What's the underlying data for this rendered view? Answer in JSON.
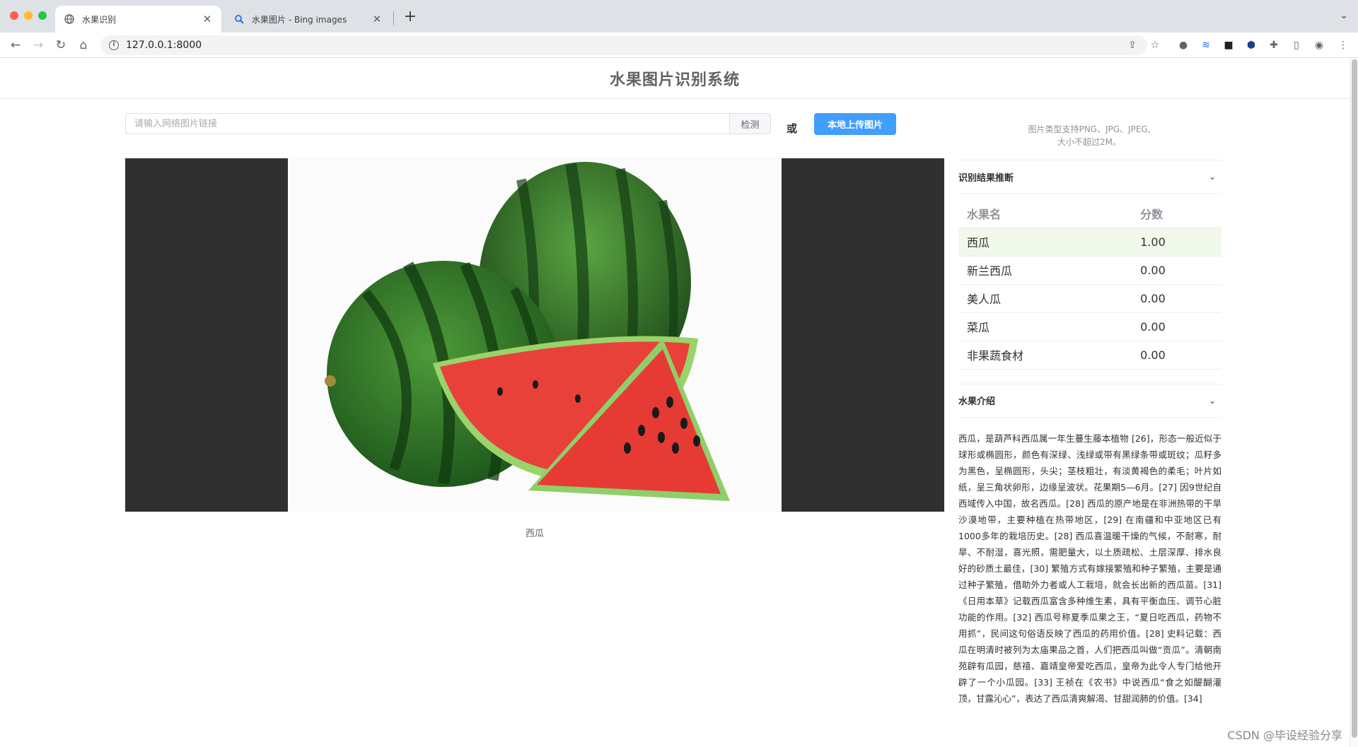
{
  "browser": {
    "tabs": [
      {
        "title": "水果识别",
        "icon": "globe-icon",
        "active": true
      },
      {
        "title": "水果图片 - Bing images",
        "icon": "bing-search-icon",
        "active": false
      }
    ],
    "address": "127.0.0.1:8000"
  },
  "page": {
    "title": "水果图片识别系统",
    "url_input_placeholder": "请输入网络图片链接",
    "detect_label": "检测",
    "or_label": "或",
    "upload_label": "本地上传图片",
    "hint_line1": "图片类型支持PNG、JPG、JPEG,",
    "hint_line2": "大小不超过2M。",
    "image_caption": "西瓜"
  },
  "result_panel": {
    "title": "识别结果推断",
    "columns": [
      "水果名",
      "分数"
    ],
    "rows": [
      {
        "name": "西瓜",
        "score": "1.00"
      },
      {
        "name": "新兰西瓜",
        "score": "0.00"
      },
      {
        "name": "美人瓜",
        "score": "0.00"
      },
      {
        "name": "菜瓜",
        "score": "0.00"
      },
      {
        "name": "非果蔬食材",
        "score": "0.00"
      }
    ]
  },
  "intro_panel": {
    "title": "水果介绍",
    "text": "西瓜，是葫芦科西瓜属一年生蔓生藤本植物 [26]，形态一般近似于球形或椭圆形，颜色有深绿、浅绿或带有黑绿条带或斑纹；瓜籽多为黑色，呈椭圆形，头尖；茎枝粗壮，有淡黄褐色的柔毛；叶片如纸，呈三角状卵形，边缘呈波状。花果期5—6月。[27] 因9世纪自西域传入中国，故名西瓜。[28] 西瓜的原产地是在非洲热带的干旱沙漠地带，主要种植在热带地区，[29] 在南疆和中亚地区已有1000多年的栽培历史。[28] 西瓜喜温暖干燥的气候，不耐寒，耐旱、不耐湿，喜光照，需肥量大，以土质疏松、土层深厚、排水良好的砂质土最佳，[30] 繁殖方式有嫁接繁殖和种子繁殖，主要是通过种子繁殖，借助外力者或人工栽培，就会长出新的西瓜苗。[31]《日用本草》记载西瓜富含多种维生素，具有平衡血压、调节心脏功能的作用。[32] 西瓜号称夏季瓜果之王，“夏日吃西瓜，药物不用抓”，民间这句俗语反映了西瓜的药用价值。[28] 史料记载：西瓜在明清时被列为太庙果品之首，人们把西瓜叫做“贡瓜”。清朝南苑辟有瓜园，慈禧、嘉靖皇帝爱吃西瓜，皇帝为此令人专门给他开辟了一个小瓜园。[33] 王祯在《农书》中说西瓜“食之如醍醐灌顶，甘露沁心”，表达了西瓜清爽解渴、甘甜润肺的价值。[34]"
  },
  "footer": {
    "watermark_text": "CSDN @毕设经验分享"
  },
  "colors": {
    "primary": "#409eff",
    "top_row_bg": "#f0f9eb",
    "image_bg": "#303030"
  }
}
